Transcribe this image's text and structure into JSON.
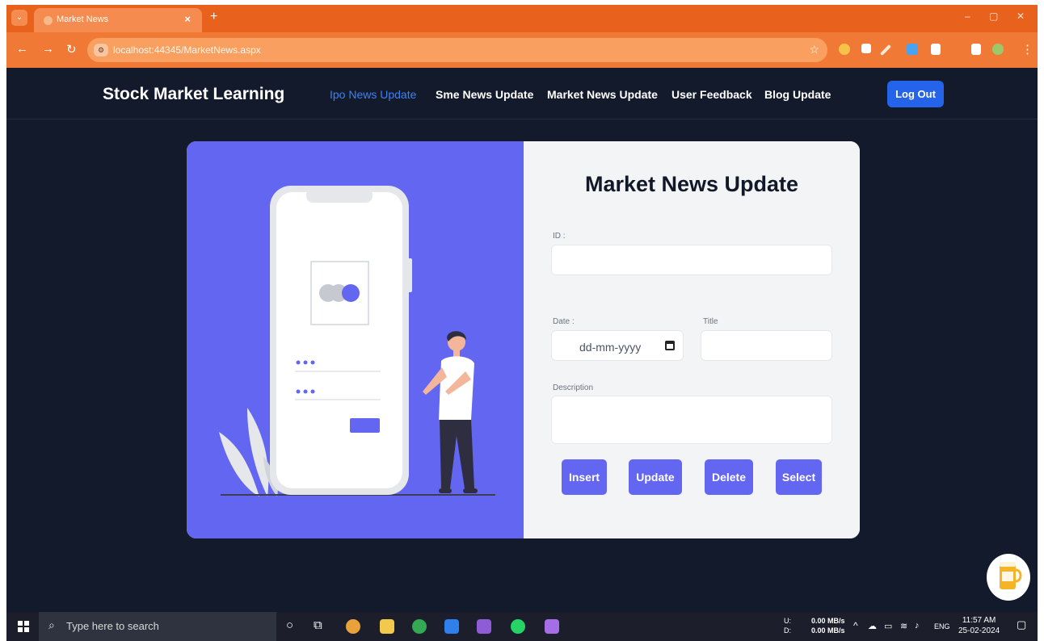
{
  "browser": {
    "tab_title": "Market News",
    "tab_close": "×",
    "new_tab": "+",
    "url": "localhost:44345/MarketNews.aspx",
    "window_controls": [
      "–",
      "▢",
      "✕"
    ]
  },
  "navbar": {
    "brand": "Stock Market Learning",
    "links": [
      "Ipo News Update",
      "Sme News Update",
      "Market News Update",
      "User Feedback",
      "Blog Update"
    ],
    "active_link": "Ipo News Update",
    "logout_label": "Log Out"
  },
  "form": {
    "title": "Market News Update",
    "id_label": "ID :",
    "date_label": "Date :",
    "date_placeholder": "dd-mm-yyyy",
    "title_label": "Title",
    "description_label": "Description",
    "buttons": [
      "Insert",
      "Update",
      "Delete",
      "Select"
    ]
  },
  "taskbar": {
    "search_placeholder": "Type here to search",
    "net_up_label": "U:",
    "net_down_label": "D:",
    "net_up": "0.00 MB/s",
    "net_down": "0.00 MB/s",
    "language": "ENG",
    "time": "11:57 AM",
    "date": "25-02-2024"
  },
  "colors": {
    "accent": "#6366f1",
    "page_bg": "#131a2b",
    "browser_orange": "#e8621d",
    "logout_blue": "#2563eb",
    "active_link": "#3b82f6"
  }
}
